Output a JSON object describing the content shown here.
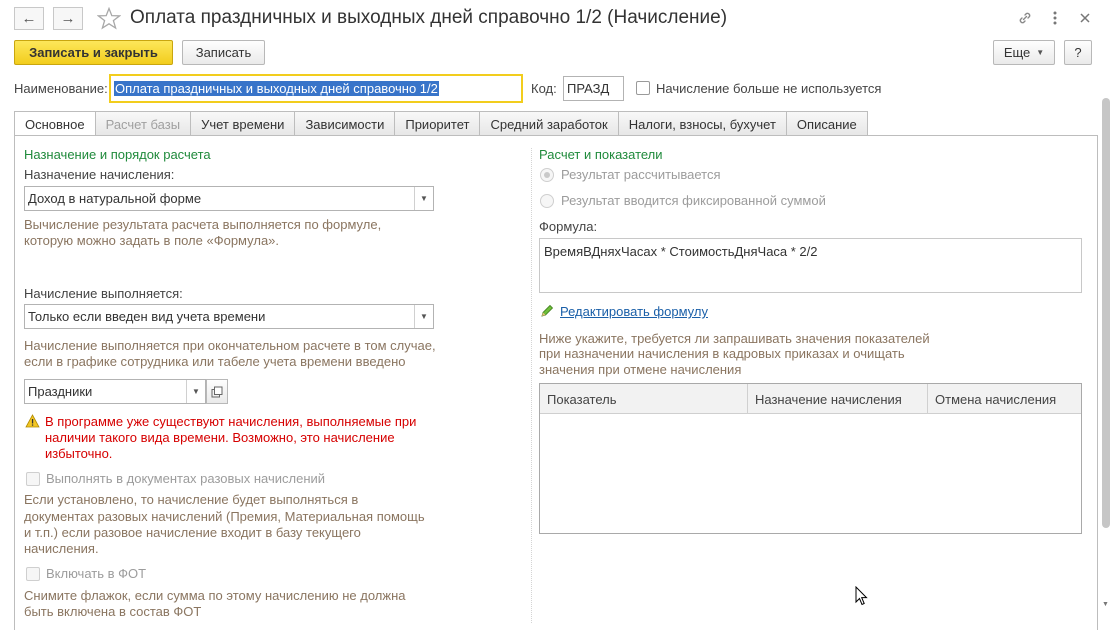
{
  "window": {
    "title": "Оплата праздничных и выходных дней справочно 1/2 (Начисление)",
    "back_icon": "arrow-left-icon",
    "forward_icon": "arrow-right-icon",
    "star_icon": "star-icon",
    "link_icon": "link-icon",
    "more_icon": "more-vertical-icon",
    "close_icon": "close-icon"
  },
  "toolbar": {
    "save_close_label": "Записать и закрыть",
    "save_label": "Записать",
    "more_label": "Еще",
    "help_label": "?"
  },
  "header": {
    "name_label": "Наименование:",
    "name_value": "Оплата праздничных и выходных дней справочно 1/2",
    "code_label": "Код:",
    "code_value": "ПРАЗД",
    "unused_label": "Начисление больше не используется"
  },
  "tabs": [
    {
      "label": "Основное"
    },
    {
      "label": "Расчет базы"
    },
    {
      "label": "Учет времени"
    },
    {
      "label": "Зависимости"
    },
    {
      "label": "Приоритет"
    },
    {
      "label": "Средний заработок"
    },
    {
      "label": "Налоги, взносы, бухучет"
    },
    {
      "label": "Описание"
    }
  ],
  "left": {
    "section_title": "Назначение и порядок расчета",
    "purpose_label": "Назначение начисления:",
    "purpose_value": "Доход в натуральной форме",
    "purpose_hint_1": "Вычисление результата расчета выполняется по формуле,",
    "purpose_hint_2": "которую можно задать в поле «Формула».",
    "executed_label": "Начисление выполняется:",
    "executed_value": "Только если введен вид учета времени",
    "executed_hint_1": "Начисление выполняется при окончательном расчете в том случае,",
    "executed_hint_2": "если в графике сотрудника или табеле учета времени введено",
    "time_type_value": "Праздники",
    "warning_1": "В программе уже существуют начисления, выполняемые при",
    "warning_2": "наличии такого вида времени. Возможно, это начисление",
    "warning_3": "избыточно.",
    "onetime_label": "Выполнять в документах разовых начислений",
    "onetime_hint_1": "Если установлено, то начисление будет выполняться в",
    "onetime_hint_2": "документах разовых начислений (Премия, Материальная помощь",
    "onetime_hint_3": "и т.п.) если разовое начисление входит в базу текущего",
    "onetime_hint_4": "начисления.",
    "fot_label": "Включать в ФОТ",
    "fot_hint_1": "Снимите флажок, если сумма по этому начислению не должна",
    "fot_hint_2": "быть включена в состав ФОТ"
  },
  "right": {
    "section_title": "Расчет и показатели",
    "radio_calculated": "Результат рассчитывается",
    "radio_fixed": "Результат вводится фиксированной суммой",
    "formula_label": "Формула:",
    "formula_value": "ВремяВДняхЧасах * СтоимостьДняЧаса * 2/2",
    "edit_formula_link": "Редактировать формулу",
    "indicators_hint_1": "Ниже укажите, требуется ли запрашивать значения показателей",
    "indicators_hint_2": "при назначении начисления в кадровых приказах и очищать",
    "indicators_hint_3": "значения при отмене начисления",
    "table_columns": [
      "Показатель",
      "Назначение начисления",
      "Отмена начисления"
    ]
  },
  "colors": {
    "primary_button": "#f2cd1d",
    "section_title": "#1f8a3b",
    "hint_text": "#8a7560",
    "warning_text": "#d60000",
    "link": "#1a5fa8",
    "selection": "#3874c9"
  }
}
